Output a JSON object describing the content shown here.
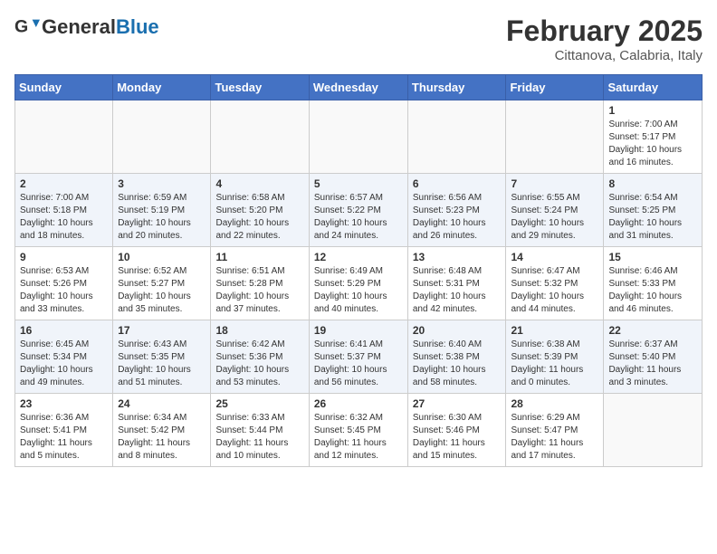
{
  "header": {
    "logo_general": "General",
    "logo_blue": "Blue",
    "month_year": "February 2025",
    "location": "Cittanova, Calabria, Italy"
  },
  "days_of_week": [
    "Sunday",
    "Monday",
    "Tuesday",
    "Wednesday",
    "Thursday",
    "Friday",
    "Saturday"
  ],
  "weeks": [
    [
      {
        "day": "",
        "info": ""
      },
      {
        "day": "",
        "info": ""
      },
      {
        "day": "",
        "info": ""
      },
      {
        "day": "",
        "info": ""
      },
      {
        "day": "",
        "info": ""
      },
      {
        "day": "",
        "info": ""
      },
      {
        "day": "1",
        "info": "Sunrise: 7:00 AM\nSunset: 5:17 PM\nDaylight: 10 hours\nand 16 minutes."
      }
    ],
    [
      {
        "day": "2",
        "info": "Sunrise: 7:00 AM\nSunset: 5:18 PM\nDaylight: 10 hours\nand 18 minutes."
      },
      {
        "day": "3",
        "info": "Sunrise: 6:59 AM\nSunset: 5:19 PM\nDaylight: 10 hours\nand 20 minutes."
      },
      {
        "day": "4",
        "info": "Sunrise: 6:58 AM\nSunset: 5:20 PM\nDaylight: 10 hours\nand 22 minutes."
      },
      {
        "day": "5",
        "info": "Sunrise: 6:57 AM\nSunset: 5:22 PM\nDaylight: 10 hours\nand 24 minutes."
      },
      {
        "day": "6",
        "info": "Sunrise: 6:56 AM\nSunset: 5:23 PM\nDaylight: 10 hours\nand 26 minutes."
      },
      {
        "day": "7",
        "info": "Sunrise: 6:55 AM\nSunset: 5:24 PM\nDaylight: 10 hours\nand 29 minutes."
      },
      {
        "day": "8",
        "info": "Sunrise: 6:54 AM\nSunset: 5:25 PM\nDaylight: 10 hours\nand 31 minutes."
      }
    ],
    [
      {
        "day": "9",
        "info": "Sunrise: 6:53 AM\nSunset: 5:26 PM\nDaylight: 10 hours\nand 33 minutes."
      },
      {
        "day": "10",
        "info": "Sunrise: 6:52 AM\nSunset: 5:27 PM\nDaylight: 10 hours\nand 35 minutes."
      },
      {
        "day": "11",
        "info": "Sunrise: 6:51 AM\nSunset: 5:28 PM\nDaylight: 10 hours\nand 37 minutes."
      },
      {
        "day": "12",
        "info": "Sunrise: 6:49 AM\nSunset: 5:29 PM\nDaylight: 10 hours\nand 40 minutes."
      },
      {
        "day": "13",
        "info": "Sunrise: 6:48 AM\nSunset: 5:31 PM\nDaylight: 10 hours\nand 42 minutes."
      },
      {
        "day": "14",
        "info": "Sunrise: 6:47 AM\nSunset: 5:32 PM\nDaylight: 10 hours\nand 44 minutes."
      },
      {
        "day": "15",
        "info": "Sunrise: 6:46 AM\nSunset: 5:33 PM\nDaylight: 10 hours\nand 46 minutes."
      }
    ],
    [
      {
        "day": "16",
        "info": "Sunrise: 6:45 AM\nSunset: 5:34 PM\nDaylight: 10 hours\nand 49 minutes."
      },
      {
        "day": "17",
        "info": "Sunrise: 6:43 AM\nSunset: 5:35 PM\nDaylight: 10 hours\nand 51 minutes."
      },
      {
        "day": "18",
        "info": "Sunrise: 6:42 AM\nSunset: 5:36 PM\nDaylight: 10 hours\nand 53 minutes."
      },
      {
        "day": "19",
        "info": "Sunrise: 6:41 AM\nSunset: 5:37 PM\nDaylight: 10 hours\nand 56 minutes."
      },
      {
        "day": "20",
        "info": "Sunrise: 6:40 AM\nSunset: 5:38 PM\nDaylight: 10 hours\nand 58 minutes."
      },
      {
        "day": "21",
        "info": "Sunrise: 6:38 AM\nSunset: 5:39 PM\nDaylight: 11 hours\nand 0 minutes."
      },
      {
        "day": "22",
        "info": "Sunrise: 6:37 AM\nSunset: 5:40 PM\nDaylight: 11 hours\nand 3 minutes."
      }
    ],
    [
      {
        "day": "23",
        "info": "Sunrise: 6:36 AM\nSunset: 5:41 PM\nDaylight: 11 hours\nand 5 minutes."
      },
      {
        "day": "24",
        "info": "Sunrise: 6:34 AM\nSunset: 5:42 PM\nDaylight: 11 hours\nand 8 minutes."
      },
      {
        "day": "25",
        "info": "Sunrise: 6:33 AM\nSunset: 5:44 PM\nDaylight: 11 hours\nand 10 minutes."
      },
      {
        "day": "26",
        "info": "Sunrise: 6:32 AM\nSunset: 5:45 PM\nDaylight: 11 hours\nand 12 minutes."
      },
      {
        "day": "27",
        "info": "Sunrise: 6:30 AM\nSunset: 5:46 PM\nDaylight: 11 hours\nand 15 minutes."
      },
      {
        "day": "28",
        "info": "Sunrise: 6:29 AM\nSunset: 5:47 PM\nDaylight: 11 hours\nand 17 minutes."
      },
      {
        "day": "",
        "info": ""
      }
    ]
  ]
}
